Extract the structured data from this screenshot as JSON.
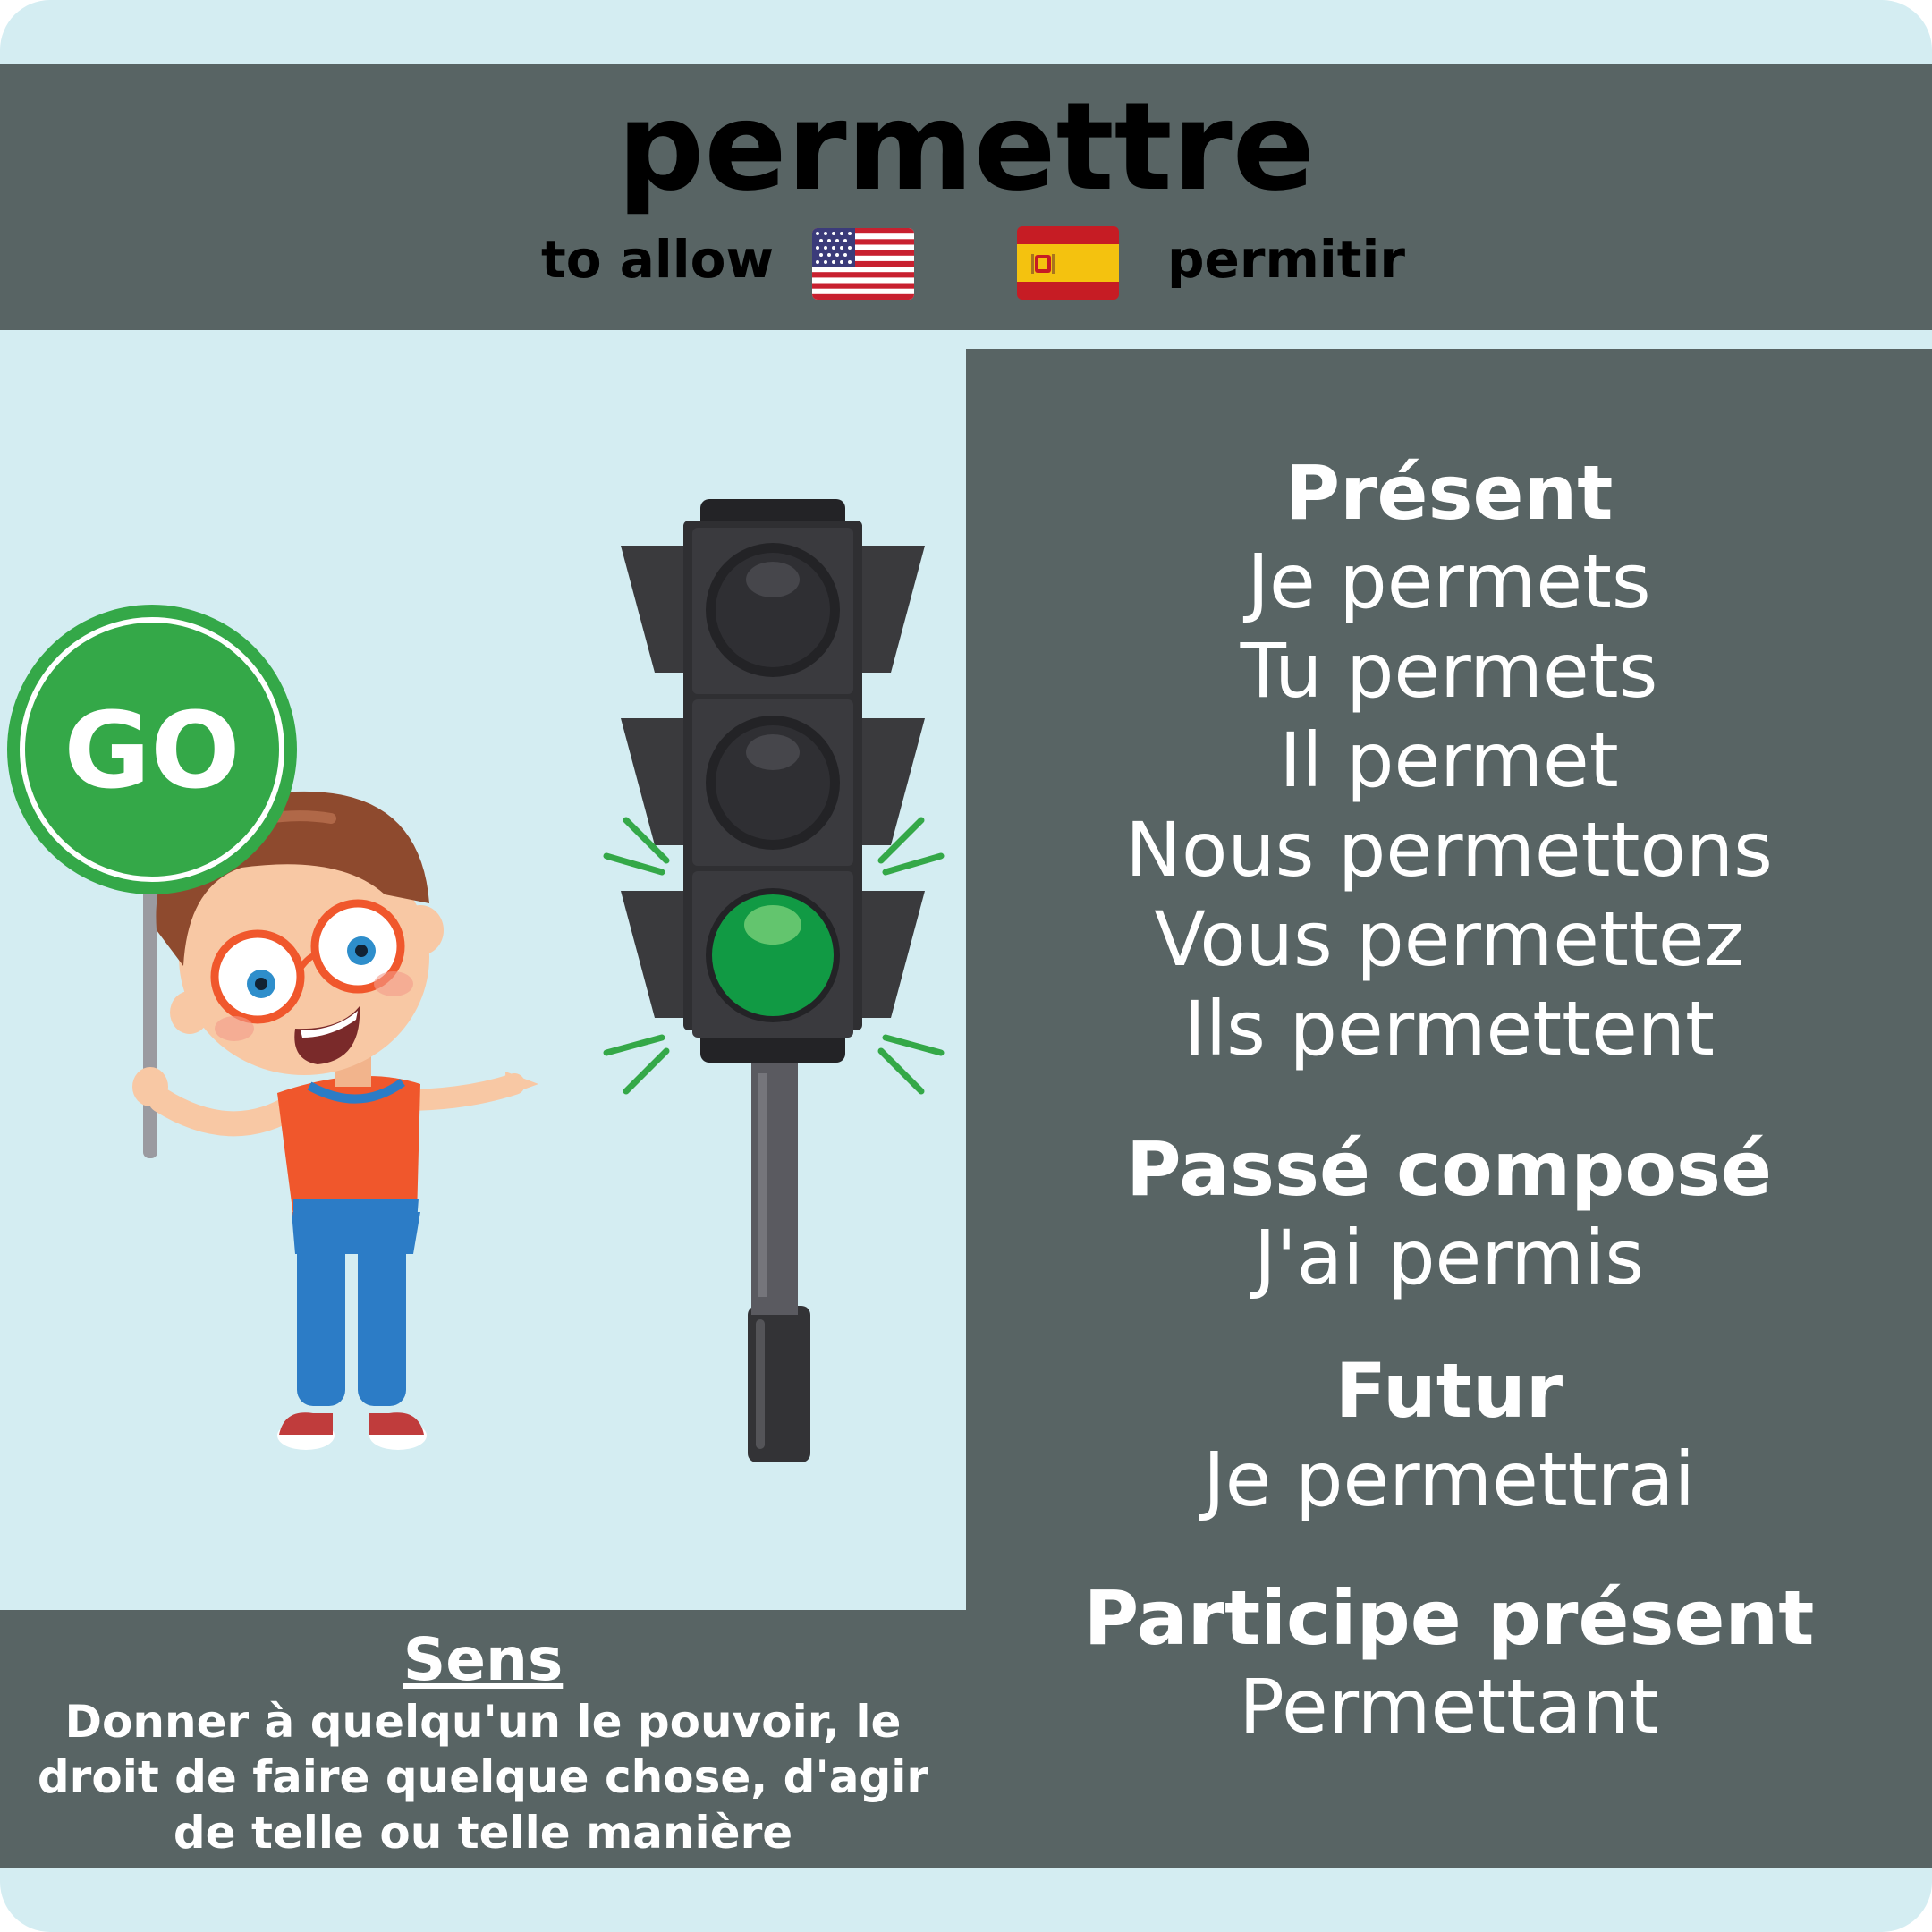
{
  "header": {
    "verb": "permettre",
    "english_translation": "to allow",
    "spanish_translation": "permitir",
    "flags": [
      "us-flag-icon",
      "spain-flag-icon"
    ]
  },
  "illustration": {
    "sign_text": "GO",
    "items": [
      "boy-with-glasses",
      "go-sign-icon",
      "traffic-light-icon"
    ],
    "lit_signal": "green"
  },
  "conjugation": {
    "present": {
      "title": "Présent",
      "lines": [
        "Je permets",
        "Tu permets",
        "Il permet",
        "Nous permettons",
        "Vous permettez",
        "Ils permettent"
      ]
    },
    "passe_compose": {
      "title": "Passé composé",
      "lines": [
        "J'ai permis"
      ]
    },
    "futur": {
      "title": "Futur",
      "lines": [
        "Je permettrai"
      ]
    },
    "participe_present": {
      "title": "Participe présent",
      "lines": [
        "Permettant"
      ]
    }
  },
  "meaning": {
    "title": "Sens",
    "text": "Donner à quelqu'un le pouvoir, le droit de faire quelque chose, d'agir de telle ou telle manière"
  },
  "colors": {
    "background": "#d4edf2",
    "panel": "#586464",
    "text": "#ffffff",
    "go_green": "#34a848",
    "light_green": "#119a44"
  }
}
